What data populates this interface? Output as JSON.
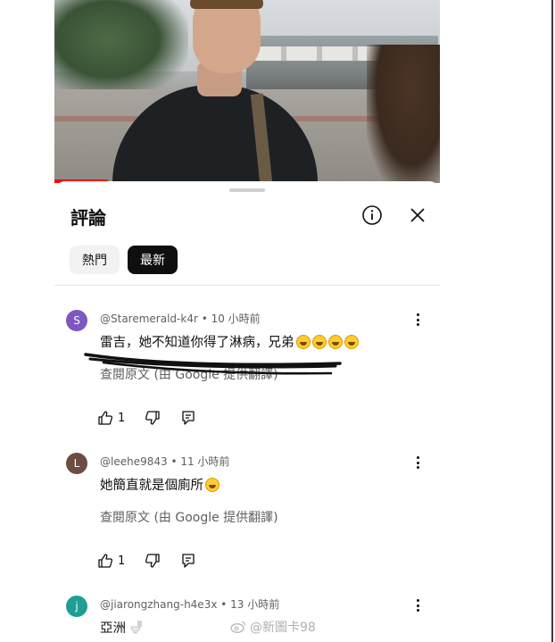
{
  "sheet": {
    "title": "評論",
    "info_icon": "info-icon",
    "close_icon": "close-icon",
    "chips": [
      {
        "label": "熱門",
        "selected": false
      },
      {
        "label": "最新",
        "selected": true
      }
    ]
  },
  "comments": [
    {
      "avatar_letter": "S",
      "avatar_color": "#7e57c2",
      "meta": "@Staremerald-k4r • 10 小時前",
      "text": "雷吉，她不知道你得了淋病，兄弟",
      "emoji_count": 4,
      "translate": "查閱原文 (由 Google 提供翻譯)",
      "likes": "1"
    },
    {
      "avatar_letter": "L",
      "avatar_color": "#6d4c41",
      "meta": "@leehe9843 • 11 小時前",
      "text": "她簡直就是個廁所",
      "emoji_count": 1,
      "translate": "查閱原文 (由 Google 提供翻譯)",
      "likes": "1"
    },
    {
      "avatar_letter": "j",
      "avatar_color": "#1e9e94",
      "meta": "@jiarongzhang-h4e3x • 13 小時前",
      "text": "亞洲",
      "emoji_count": 0
    }
  ],
  "watermark": "@新圖卡98",
  "colors": {
    "accent_red": "#ff0000",
    "chip_selected": "#0f0f0f",
    "chip_idle": "#f2f2f2",
    "meta_text": "#606060"
  }
}
